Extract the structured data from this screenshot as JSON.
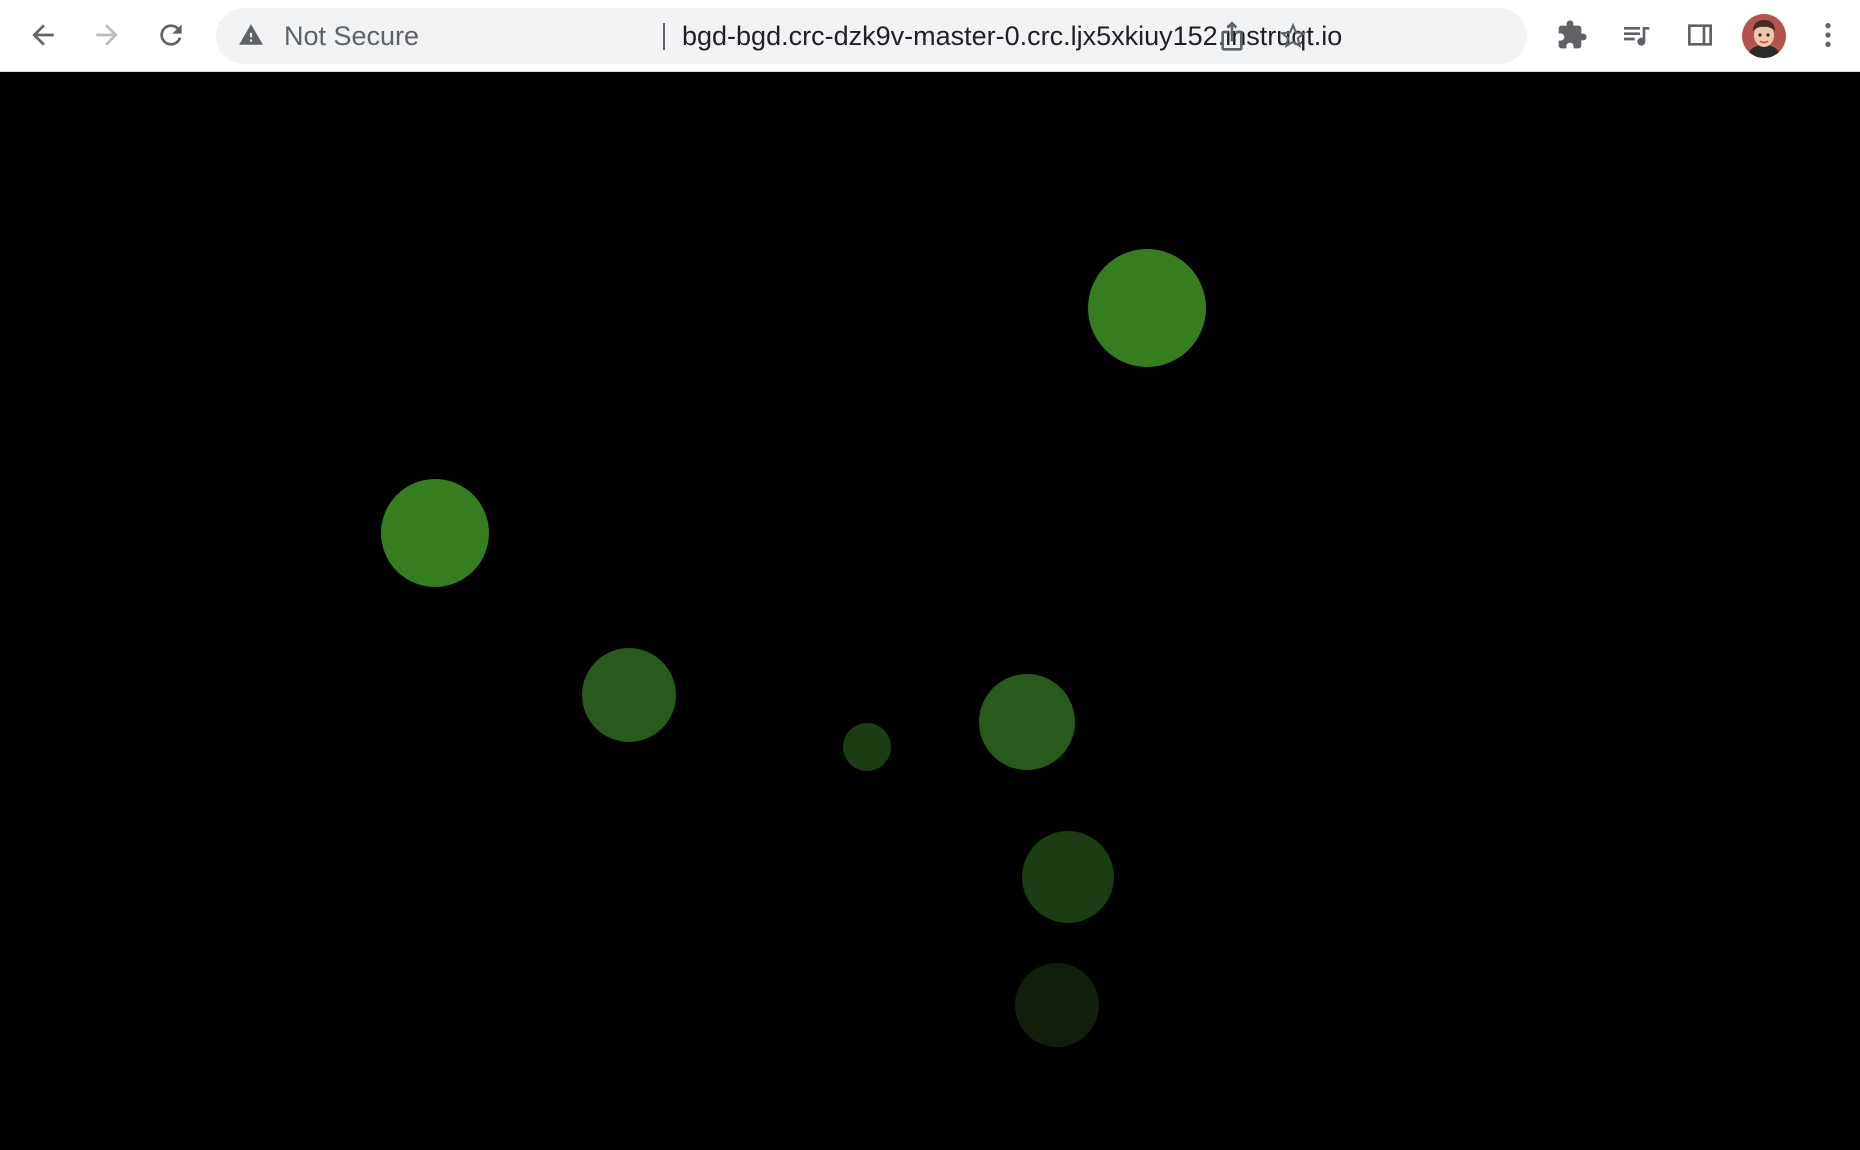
{
  "browser": {
    "security_label": "Not Secure",
    "url": "bgd-bgd.crc-dzk9v-master-0.crc.ljx5xkiuy152.instruqt.io",
    "icons": {
      "back": "back-arrow-icon",
      "forward": "forward-arrow-icon",
      "reload": "reload-icon",
      "security": "warning-triangle-icon",
      "share": "share-icon",
      "bookmark": "star-icon",
      "extensions": "puzzle-piece-icon",
      "media": "media-queue-icon",
      "side_panel": "side-panel-icon",
      "profile": "avatar",
      "menu": "kebab-menu-icon"
    }
  },
  "page": {
    "background": "#000000",
    "ball_color": "#3a8a24"
  }
}
